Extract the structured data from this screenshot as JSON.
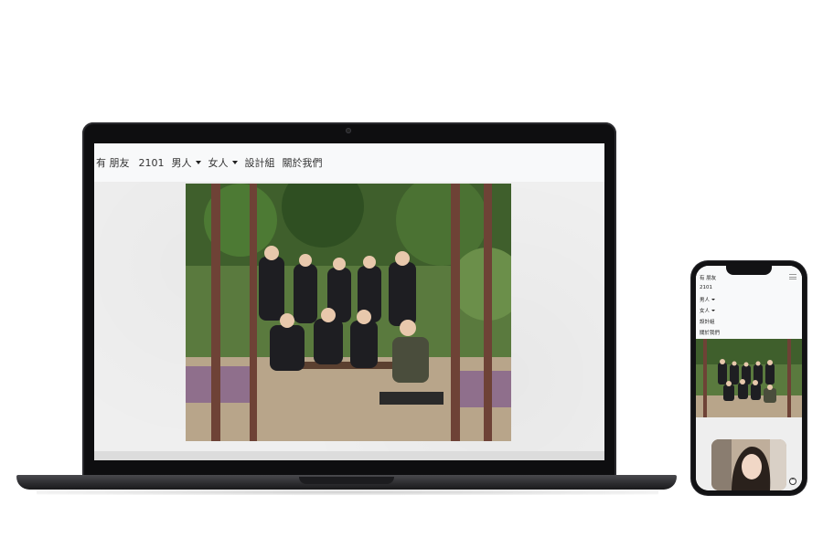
{
  "site": {
    "brand": "有 朋友",
    "nav": [
      {
        "label": "2101",
        "dropdown": false
      },
      {
        "label": "男人",
        "dropdown": true
      },
      {
        "label": "女人",
        "dropdown": true
      },
      {
        "label": "設計組",
        "dropdown": false
      },
      {
        "label": "關於我們",
        "dropdown": false
      }
    ]
  },
  "mobile": {
    "brand": "有 朋友",
    "nav": [
      {
        "label": "2101"
      },
      {
        "label": "男人"
      },
      {
        "label": "女人"
      },
      {
        "label": "設計組"
      },
      {
        "label": "關於我們"
      }
    ],
    "menu_icon": "hamburger-icon",
    "scroll_top_icon": "chevron-up-circle-icon"
  },
  "colors": {
    "navbar_bg": "#f8f9fa",
    "device_frame": "#0e0e10",
    "page_bg": "#efefef"
  }
}
